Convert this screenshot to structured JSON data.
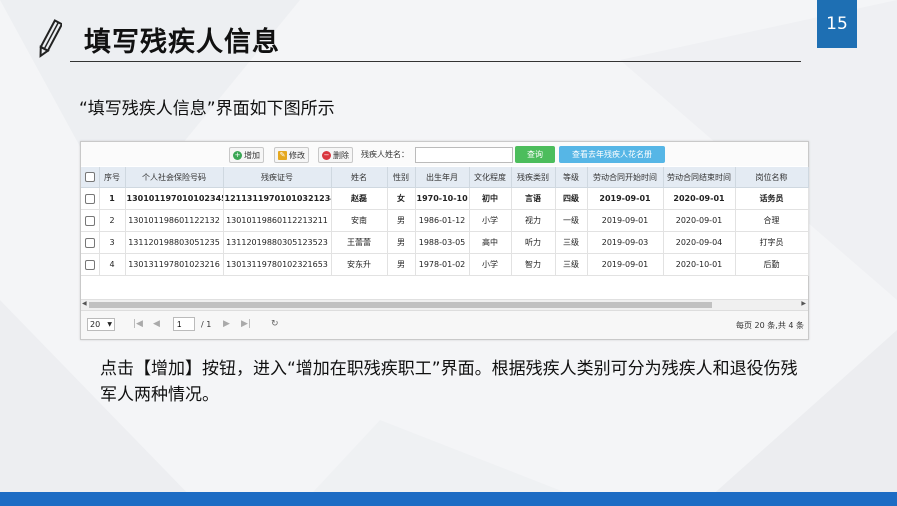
{
  "slide": {
    "title": "填写残疾人信息",
    "page_number": "15",
    "intro": "“填写残疾人信息”界面如下图所示",
    "description": "点击【增加】按钮，进入“增加在职残疾职工”界面。根据残疾人类别可分为残疾人和退役伤残军人两种情况。"
  },
  "toolbar": {
    "add_label": "增加",
    "edit_label": "修改",
    "delete_label": "删除",
    "search_label": "残疾人姓名：",
    "search_value": "",
    "query_label": "查询",
    "list_label": "查看去年残疾人花名册"
  },
  "table": {
    "columns": [
      "序号",
      "个人社会保险号码",
      "残疾证号",
      "姓名",
      "性别",
      "出生年月",
      "文化程度",
      "残疾类别",
      "等级",
      "劳动合同开始时间",
      "劳动合同结束时间",
      "岗位名称"
    ],
    "rows": [
      [
        "1",
        "130101197010102345",
        "12113119701010321234",
        "赵磊",
        "女",
        "1970-10-10",
        "初中",
        "言语",
        "四级",
        "2019-09-01",
        "2020-09-01",
        "话务员"
      ],
      [
        "2",
        "130101198601122132",
        "13010119860112213211",
        "安南",
        "男",
        "1986-01-12",
        "小学",
        "视力",
        "一级",
        "2019-09-01",
        "2020-09-01",
        "合理"
      ],
      [
        "3",
        "131120198803051235",
        "13112019880305123523",
        "王蕾蕾",
        "男",
        "1988-03-05",
        "高中",
        "听力",
        "三级",
        "2019-09-03",
        "2020-09-04",
        "打字员"
      ],
      [
        "4",
        "130131197801023216",
        "13013119780102321653",
        "安东升",
        "男",
        "1978-01-02",
        "小学",
        "智力",
        "三级",
        "2019-09-01",
        "2020-10-01",
        "后勤"
      ]
    ]
  },
  "pager": {
    "page_size": "20",
    "current_page": "1",
    "total_pages": "/ 1",
    "info": "每页 20 条,共 4 条"
  },
  "colors": {
    "accent_blue": "#1e6fb3",
    "footer_blue": "#1d6cc4",
    "query_green": "#4cbd5c",
    "list_blue": "#56b6e6"
  }
}
